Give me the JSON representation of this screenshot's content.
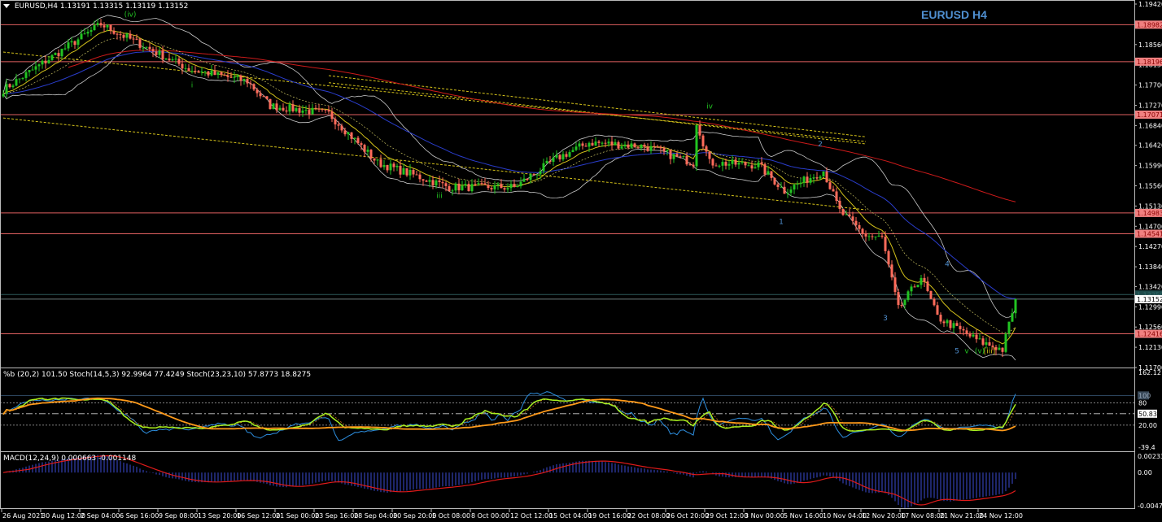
{
  "header": {
    "symbol": "EURUSD,H4",
    "open": "1.13191",
    "high": "1.13315",
    "low": "1.13119",
    "close": "1.13152"
  },
  "chart_title": "EURUSD H4",
  "indicators": {
    "osc_label": "%b (20,2) 101.50  Stoch(14,5,3) 92.9964 77.4249   Stoch(23,23,10) 57.8773 18.8275",
    "macd_label": "MACD(12,24,9) 0.000663 -0.001148"
  },
  "colors": {
    "bg": "#000000",
    "bull": "#22c422",
    "bear": "#ff6b5a",
    "level": "#e06060",
    "ma_fast": "#d4c21a",
    "ma_mid": "#2a3dcc",
    "ma_slow": "#cc1a1a",
    "bands": "#c8c8c8",
    "stoch_main": "#a8f020",
    "stoch_slow": "#ff9a1a",
    "pctb": "#2d8fe0",
    "macd_hist": "#3340b0",
    "macd_signal": "#e01a1a"
  },
  "chart_data": {
    "type": "candlestick",
    "timeframe": "H4",
    "ylim": [
      1.117,
      1.1942
    ],
    "price_ticks": [
      "1.19420",
      "1.18560",
      "1.18130",
      "1.17700",
      "1.17270",
      "1.16840",
      "1.16420",
      "1.15990",
      "1.15560",
      "1.15130",
      "1.14700",
      "1.14270",
      "1.13840",
      "1.13420",
      "1.12990",
      "1.12560",
      "1.12130",
      "1.11700"
    ],
    "levels": [
      {
        "price": 1.18982,
        "label": "1.18982"
      },
      {
        "price": 1.18196,
        "label": "1.18196"
      },
      {
        "price": 1.17071,
        "label": "1.17071"
      },
      {
        "price": 1.14983,
        "label": "1.14983"
      },
      {
        "price": 1.14541,
        "label": "1.14541"
      },
      {
        "price": 1.12416,
        "label": "1.12416"
      }
    ],
    "current_price": {
      "price": 1.13152,
      "label": "1.13152"
    },
    "price_path": [
      [
        0,
        1.176
      ],
      [
        15,
        1.183
      ],
      [
        30,
        1.1899
      ],
      [
        40,
        1.1864
      ],
      [
        57,
        1.1804
      ],
      [
        75,
        1.1778
      ],
      [
        82,
        1.1726
      ],
      [
        100,
        1.1709
      ],
      [
        115,
        1.1605
      ],
      [
        137,
        1.1553
      ],
      [
        157,
        1.1553
      ],
      [
        170,
        1.1614
      ],
      [
        180,
        1.1648
      ],
      [
        197,
        1.164
      ],
      [
        212,
        1.1605
      ],
      [
        213,
        1.1692
      ],
      [
        217,
        1.1605
      ],
      [
        232,
        1.16
      ],
      [
        240,
        1.1545
      ],
      [
        252,
        1.1588
      ],
      [
        257,
        1.1502
      ],
      [
        265,
        1.145
      ],
      [
        270,
        1.1445
      ],
      [
        275,
        1.1294
      ],
      [
        282,
        1.1363
      ],
      [
        287,
        1.1277
      ],
      [
        300,
        1.1225
      ],
      [
        307,
        1.1208
      ],
      [
        311,
        1.1315
      ]
    ],
    "x_labels": [
      "26 Aug 2021",
      "30 Aug 12:00",
      "2 Sep 04:00",
      "6 Sep 16:00",
      "9 Sep 08:00",
      "13 Sep 20:00",
      "16 Sep 12:00",
      "21 Sep 00:00",
      "23 Sep 16:00",
      "28 Sep 04:00",
      "30 Sep 20:00",
      "5 Oct 08:00",
      "8 Oct 00:00",
      "12 Oct 12:00",
      "15 Oct 04:00",
      "19 Oct 16:00",
      "22 Oct 08:00",
      "26 Oct 20:00",
      "29 Oct 12:00",
      "3 Nov 00:00",
      "5 Nov 16:00",
      "10 Nov 04:00",
      "12 Nov 20:00",
      "17 Nov 08:00",
      "21 Nov 21:00",
      "24 Nov 12:00"
    ],
    "wave_labels": [
      {
        "text": "(iv)",
        "bar": 39,
        "price": 1.1915,
        "color": "#22c422"
      },
      {
        "text": "i",
        "bar": 58,
        "price": 1.1765,
        "color": "#22c422"
      },
      {
        "text": "iii",
        "bar": 134,
        "price": 1.153,
        "color": "#22c422"
      },
      {
        "text": "iv",
        "bar": 217,
        "price": 1.172,
        "color": "#22c422"
      },
      {
        "text": "1",
        "bar": 239,
        "price": 1.1475,
        "color": "#4f8fd0"
      },
      {
        "text": "2",
        "bar": 251,
        "price": 1.164,
        "color": "#4f8fd0"
      },
      {
        "text": "3",
        "bar": 271,
        "price": 1.127,
        "color": "#4f8fd0"
      },
      {
        "text": "4",
        "bar": 290,
        "price": 1.1385,
        "color": "#4f8fd0"
      },
      {
        "text": "5",
        "bar": 293,
        "price": 1.12,
        "color": "#4f8fd0"
      },
      {
        "text": "v",
        "bar": 296,
        "price": 1.12,
        "color": "#22c422"
      },
      {
        "text": "(v)",
        "bar": 300,
        "price": 1.12,
        "color": "#22c422"
      },
      {
        "text": "[iii]",
        "bar": 303,
        "price": 1.12,
        "color": "#d4c21a"
      }
    ],
    "osc": {
      "ylim": [
        -39.4,
        162.12
      ],
      "ticks": [
        "162.12",
        "80",
        "100",
        "50.83",
        "20.00",
        "-39.4"
      ],
      "levels": [
        80,
        50.83,
        20
      ]
    },
    "macd": {
      "ylim": [
        -0.004719,
        0.002335
      ],
      "ticks": [
        "0.002335",
        "0.00",
        "-0.004719"
      ],
      "fast": 12,
      "slow": 24,
      "signal": 9
    }
  }
}
